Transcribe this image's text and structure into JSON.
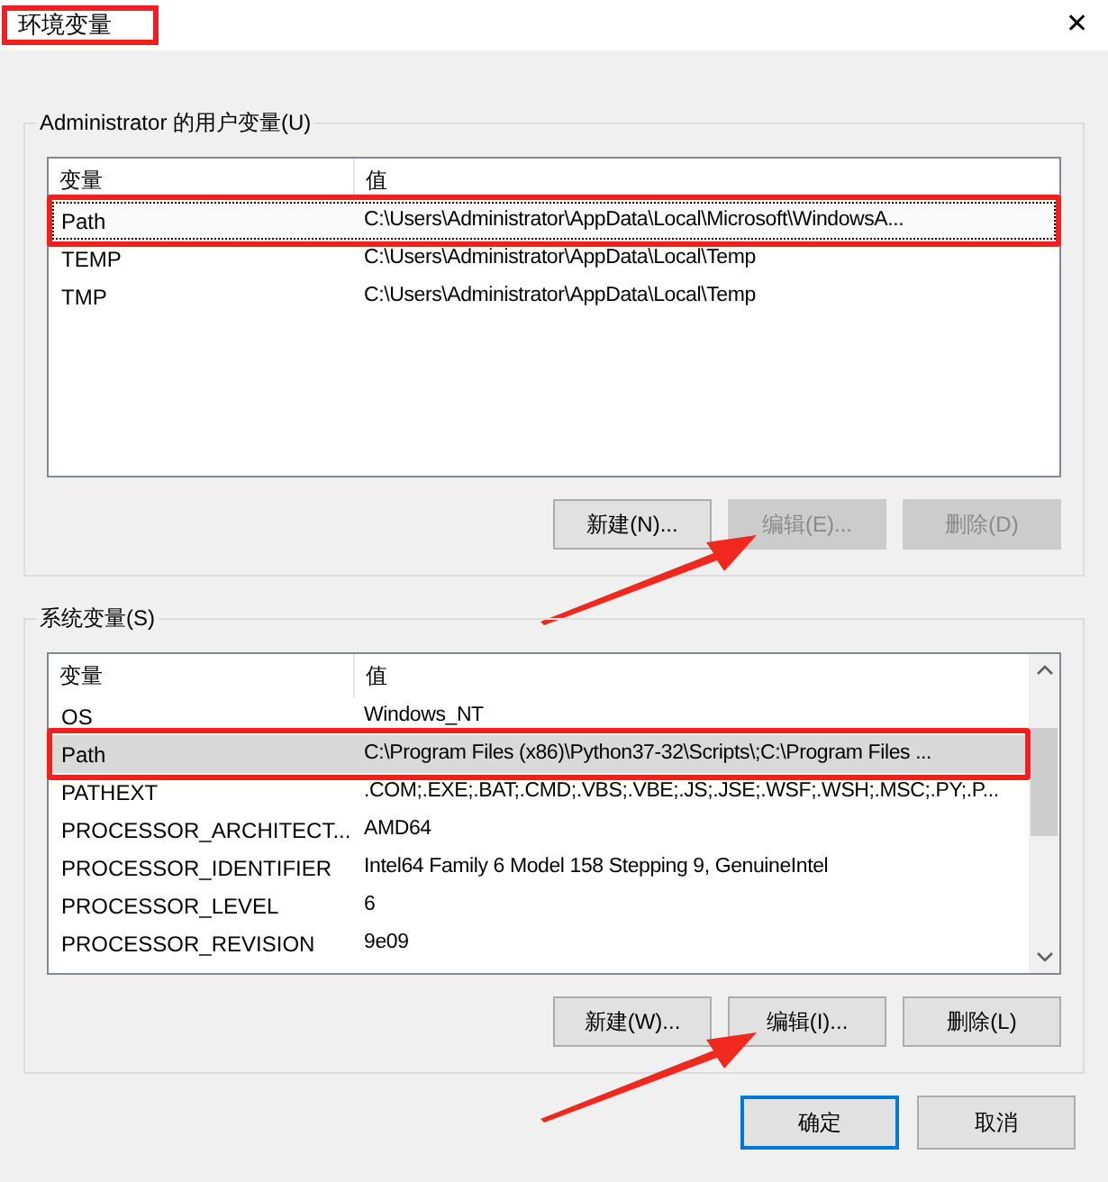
{
  "window": {
    "title": "环境变量",
    "title_highlighted": true,
    "close": "✕"
  },
  "user_vars": {
    "label": "Administrator 的用户变量(U)",
    "columns": [
      "变量",
      "值"
    ],
    "rows": [
      {
        "name": "Path",
        "value": "C:\\Users\\Administrator\\AppData\\Local\\Microsoft\\WindowsA...",
        "selected": true,
        "highlighted": true
      },
      {
        "name": "TEMP",
        "value": "C:\\Users\\Administrator\\AppData\\Local\\Temp",
        "selected": false,
        "highlighted": false
      },
      {
        "name": "TMP",
        "value": "C:\\Users\\Administrator\\AppData\\Local\\Temp",
        "selected": false,
        "highlighted": false
      }
    ],
    "buttons": [
      {
        "label": "新建(N)...",
        "disabled": false,
        "pointed": false
      },
      {
        "label": "编辑(E)...",
        "disabled": true,
        "pointed": true
      },
      {
        "label": "删除(D)",
        "disabled": true,
        "pointed": false
      }
    ]
  },
  "system_vars": {
    "label": "系统变量(S)",
    "columns": [
      "变量",
      "值"
    ],
    "rows": [
      {
        "name": "OS",
        "value": "Windows_NT",
        "selected": false,
        "highlighted": false
      },
      {
        "name": "Path",
        "value": "C:\\Program Files (x86)\\Python37-32\\Scripts\\;C:\\Program Files ...",
        "selected": true,
        "highlighted": true
      },
      {
        "name": "PATHEXT",
        "value": ".COM;.EXE;.BAT;.CMD;.VBS;.VBE;.JS;.JSE;.WSF;.WSH;.MSC;.PY;.P...",
        "selected": false,
        "highlighted": false
      },
      {
        "name": "PROCESSOR_ARCHITECT...",
        "value": "AMD64",
        "selected": false,
        "highlighted": false
      },
      {
        "name": "PROCESSOR_IDENTIFIER",
        "value": "Intel64 Family 6 Model 158 Stepping 9, GenuineIntel",
        "selected": false,
        "highlighted": false
      },
      {
        "name": "PROCESSOR_LEVEL",
        "value": "6",
        "selected": false,
        "highlighted": false
      },
      {
        "name": "PROCESSOR_REVISION",
        "value": "9e09",
        "selected": false,
        "highlighted": false
      }
    ],
    "buttons": [
      {
        "label": "新建(W)...",
        "disabled": false,
        "pointed": false
      },
      {
        "label": "编辑(I)...",
        "disabled": false,
        "pointed": true
      },
      {
        "label": "删除(L)",
        "disabled": false,
        "pointed": false
      }
    ]
  },
  "footer_buttons": [
    {
      "label": "确定",
      "default": true
    },
    {
      "label": "取消",
      "default": false
    }
  ]
}
